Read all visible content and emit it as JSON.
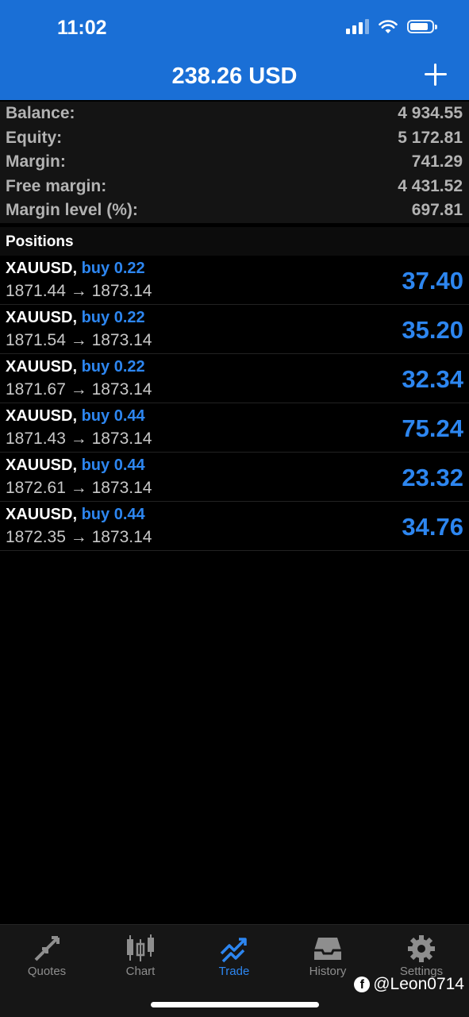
{
  "status_bar": {
    "time": "11:02"
  },
  "header": {
    "title": "238.26 USD"
  },
  "summary": [
    {
      "label": "Balance:",
      "value": "4 934.55"
    },
    {
      "label": "Equity:",
      "value": "5 172.81"
    },
    {
      "label": "Margin:",
      "value": "741.29"
    },
    {
      "label": "Free margin:",
      "value": "4 431.52"
    },
    {
      "label": "Margin level (%):",
      "value": "697.81"
    }
  ],
  "positions_title": "Positions",
  "positions": [
    {
      "symbol": "XAUUSD,",
      "type": "buy 0.22",
      "prices": "1871.44 → 1873.14",
      "profit": "37.40"
    },
    {
      "symbol": "XAUUSD,",
      "type": "buy 0.22",
      "prices": "1871.54 → 1873.14",
      "profit": "35.20"
    },
    {
      "symbol": "XAUUSD,",
      "type": "buy 0.22",
      "prices": "1871.67 → 1873.14",
      "profit": "32.34"
    },
    {
      "symbol": "XAUUSD,",
      "type": "buy 0.44",
      "prices": "1871.43 → 1873.14",
      "profit": "75.24"
    },
    {
      "symbol": "XAUUSD,",
      "type": "buy 0.44",
      "prices": "1872.61 → 1873.14",
      "profit": "23.32"
    },
    {
      "symbol": "XAUUSD,",
      "type": "buy 0.44",
      "prices": "1872.35 → 1873.14",
      "profit": "34.76"
    }
  ],
  "tabs": [
    {
      "label": "Quotes",
      "icon": "quotes-icon",
      "active": false
    },
    {
      "label": "Chart",
      "icon": "chart-icon",
      "active": false
    },
    {
      "label": "Trade",
      "icon": "trade-icon",
      "active": true
    },
    {
      "label": "History",
      "icon": "history-icon",
      "active": false
    },
    {
      "label": "Settings",
      "icon": "settings-icon",
      "active": false
    }
  ],
  "watermark": "@Leon0714",
  "colors": {
    "header": "#1a6fd6",
    "accent": "#2d86f0",
    "background": "#000000"
  }
}
